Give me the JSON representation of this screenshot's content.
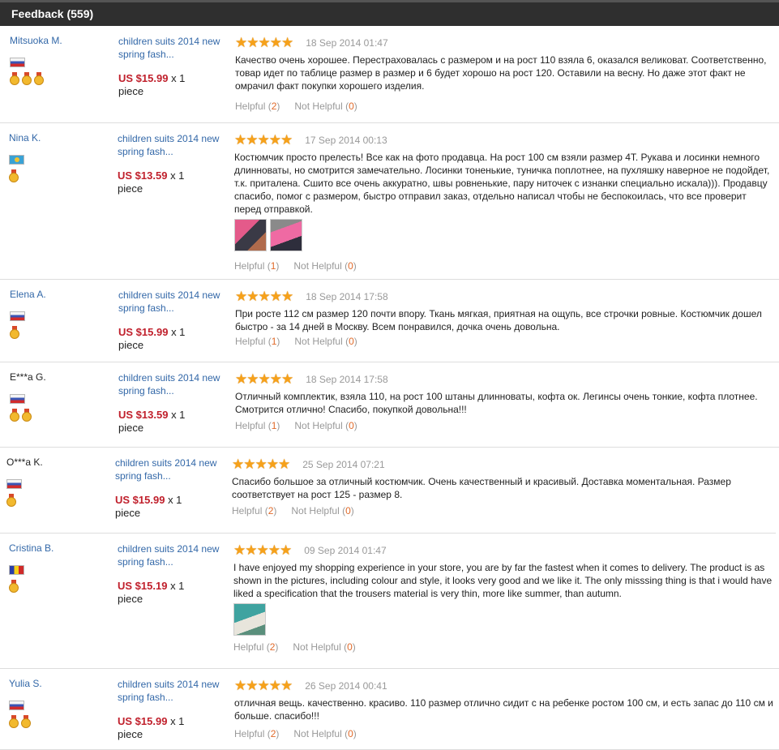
{
  "header": {
    "title": "Feedback (559)"
  },
  "labels": {
    "helpful": "Helpful",
    "not_helpful": "Not Helpful",
    "stars": "★★★★★"
  },
  "reviews": [
    {
      "user": "Mitsuoka M.",
      "flag": "russia-flag-icon",
      "medals": 3,
      "product": "children suits 2014 new spring fash...",
      "price": "US $15.99",
      "qty": "x 1",
      "unit": "piece",
      "rating": 5,
      "date": "18 Sep 2014 01:47",
      "text": "Качество очень хорошее. Перестраховалась с размером и на рост 110 взяла 6, оказался великоват. Соответственно, товар идет по таблице размер в размер и 6 будет хорошо на рост 120. Оставили на весну. Но даже этот факт не омрачил факт покупки хорошего изделия.",
      "helpful": "2",
      "not_helpful": "0",
      "photos": 0
    },
    {
      "user": "Nina K.",
      "flag": "kazakhstan-flag-icon",
      "medals": 1,
      "product": "children suits 2014 new spring fash...",
      "price": "US $13.59",
      "qty": "x 1",
      "unit": "piece",
      "rating": 5,
      "date": "17 Sep 2014 00:13",
      "text": "Костюмчик просто прелесть! Все как на фото продавца. На рост 100 см взяли размер 4Т. Рукава и лосинки немного длинноваты, но смотрится замечательно. Лосинки тоненькие, туничка поплотнее, на пухляшку наверное не подойдет, т.к. приталена. Сшито все очень аккуратно, швы ровненькие, пару ниточек с изнанки специально искала))). Продавцу спасибо, помог с размером, быстро отправил заказ, отдельно написал чтобы не беспокоилась, что все проверит перед отправкой.",
      "helpful": "1",
      "not_helpful": "0",
      "photos": 2
    },
    {
      "user": "Elena A.",
      "flag": "russia-flag-icon",
      "medals": 1,
      "product": "children suits 2014 new spring fash...",
      "price": "US $15.99",
      "qty": "x 1",
      "unit": "piece",
      "rating": 5,
      "date": "18 Sep 2014 17:58",
      "text": "При росте 112 см размер 120 почти впору. Ткань мягкая, приятная на ощупь, все строчки ровные. Костюмчик дошел быстро - за 14 дней в Москву. Всем понравился, дочка очень довольна.",
      "helpful": "1",
      "not_helpful": "0",
      "photos": 0
    },
    {
      "user": "E***a G.",
      "flag": "russia-flag-icon",
      "medals": 2,
      "product": "children suits 2014 new spring fash...",
      "price": "US $13.59",
      "qty": "x 1",
      "unit": "piece",
      "rating": 5,
      "date": "18 Sep 2014 17:58",
      "text": "Отличный комплектик, взяла 110, на рост 100 штаны длинноваты, кофта ок. Легинсы очень тонкие, кофта плотнее. Смотрится отлично! Спасибо, покупкой довольна!!!",
      "helpful": "1",
      "not_helpful": "0",
      "photos": 0
    },
    {
      "user": "O***a K.",
      "flag": "russia-flag-icon",
      "medals": 1,
      "product": "children suits 2014 new spring fash...",
      "price": "US $15.99",
      "qty": "x 1",
      "unit": "piece",
      "rating": 5,
      "date": "25 Sep 2014 07:21",
      "text": "Спасибо большое за отличный костюмчик. Очень качественный и красивый. Доставка моментальная. Размер соответствует на рост 125 - размер 8.",
      "helpful": "2",
      "not_helpful": "0",
      "photos": 0
    },
    {
      "user": "Cristina B.",
      "flag": "romania-flag-icon",
      "medals": 1,
      "product": "children suits 2014 new spring fash...",
      "price": "US $15.19",
      "qty": "x 1",
      "unit": "piece",
      "rating": 5,
      "date": "09 Sep 2014 01:47",
      "text": "I have enjoyed my shopping experience in your store, you are by far the fastest when it comes to delivery. The product is as shown in the pictures, including colour and style, it looks very good and we like it. The only misssing thing is that i would have liked a specification that the trousers material is very thin, more like summer, than autumn.",
      "helpful": "2",
      "not_helpful": "0",
      "photos": 1
    },
    {
      "user": "Yulia S.",
      "flag": "russia-flag-icon",
      "medals": 2,
      "product": "children suits 2014 new spring fash...",
      "price": "US $15.99",
      "qty": "x 1",
      "unit": "piece",
      "rating": 5,
      "date": "26 Sep 2014 00:41",
      "text": "отличная вещь. качественно. красиво. 110 размер отлично сидит с на ребенке ростом 100 см, и есть запас до 110 см и больше. спасибо!!!",
      "helpful": "2",
      "not_helpful": "0",
      "photos": 0
    }
  ]
}
